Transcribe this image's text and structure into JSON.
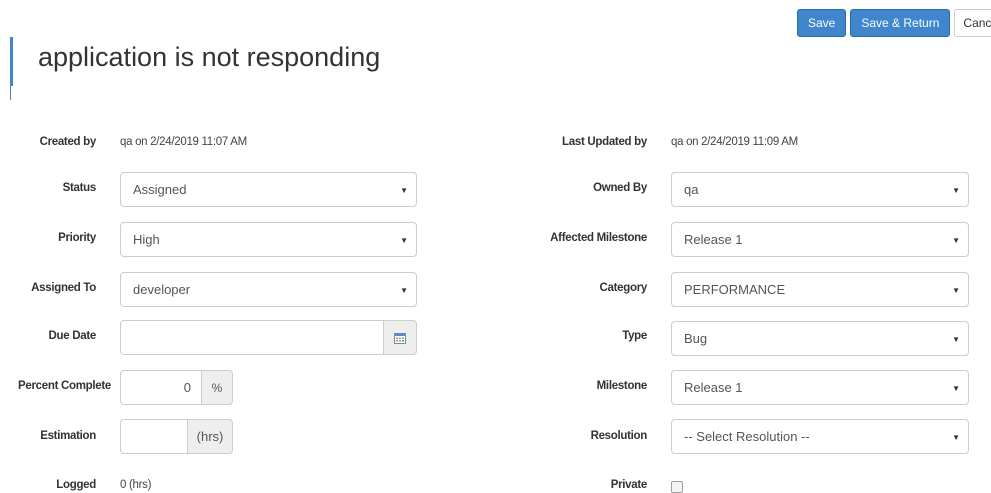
{
  "toolbar": {
    "save_label": "Save",
    "save_return_label": "Save & Return",
    "cancel_label": "Cancel"
  },
  "page_title": "application is not responding",
  "left": {
    "created_by": {
      "label": "Created by",
      "value": "qa on 2/24/2019 11:07 AM"
    },
    "status": {
      "label": "Status",
      "value": "Assigned"
    },
    "priority": {
      "label": "Priority",
      "value": "High"
    },
    "assigned_to": {
      "label": "Assigned To",
      "value": "developer"
    },
    "due_date": {
      "label": "Due Date",
      "value": ""
    },
    "percent_complete": {
      "label": "Percent Complete",
      "value": "0",
      "unit": "%"
    },
    "estimation": {
      "label": "Estimation",
      "value": "",
      "unit": "(hrs)"
    },
    "logged": {
      "label": "Logged",
      "value": "0 (hrs)"
    }
  },
  "right": {
    "last_updated_by": {
      "label": "Last Updated by",
      "value": "qa on 2/24/2019 11:09 AM"
    },
    "owned_by": {
      "label": "Owned By",
      "value": "qa"
    },
    "affected_milestone": {
      "label": "Affected Milestone",
      "value": "Release 1"
    },
    "category": {
      "label": "Category",
      "value": "PERFORMANCE"
    },
    "type": {
      "label": "Type",
      "value": "Bug"
    },
    "milestone": {
      "label": "Milestone",
      "value": "Release 1"
    },
    "resolution": {
      "label": "Resolution",
      "value": "-- Select Resolution --"
    },
    "private": {
      "label": "Private",
      "checked": false
    }
  },
  "icons": {
    "dropdown": "caret-down-icon",
    "calendar": "calendar-icon"
  },
  "colors": {
    "primary": "#3f86cd",
    "border": "#cccccc",
    "addon_bg": "#eeeeee"
  }
}
